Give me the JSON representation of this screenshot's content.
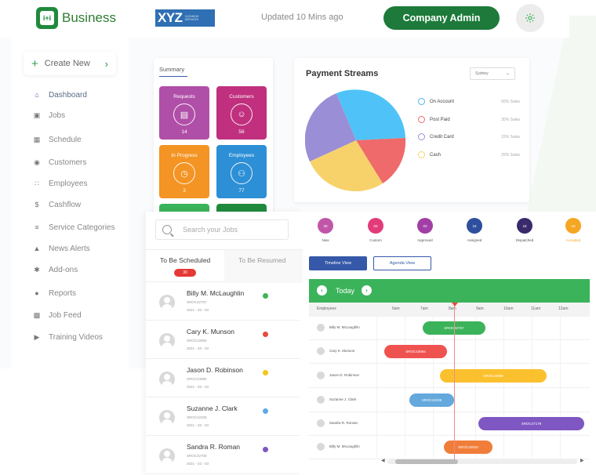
{
  "brand": {
    "logo_mark": "i+i",
    "name": "Business",
    "partner_logo_big": "XYZ",
    "partner_logo_small": "CLEANING SERVICES"
  },
  "header": {
    "updated": "Updated 10 Mins ago",
    "company_button": "Company Admin",
    "settings_icon": "gear-icon"
  },
  "sidebar": {
    "create_new": "Create New",
    "items": [
      {
        "label": "Dashboard",
        "icon": "home-icon",
        "active": true
      },
      {
        "label": "Jobs",
        "icon": "briefcase-icon"
      },
      {
        "label": "Schedule",
        "icon": "calendar-icon"
      },
      {
        "label": "Customers",
        "icon": "customer-icon"
      },
      {
        "label": "Employees",
        "icon": "people-icon"
      },
      {
        "label": "Cashflow",
        "icon": "dollar-icon"
      },
      {
        "label": "Service Categories",
        "icon": "list-icon"
      },
      {
        "label": "News Alerts",
        "icon": "bell-icon"
      },
      {
        "label": "Add-ons",
        "icon": "puzzle-icon"
      },
      {
        "label": "Reports",
        "icon": "report-icon"
      },
      {
        "label": "Job Feed",
        "icon": "feed-icon"
      },
      {
        "label": "Training Videos",
        "icon": "video-icon"
      }
    ]
  },
  "summary": {
    "title": "Summary",
    "tiles": [
      {
        "label": "Requests",
        "value": "14",
        "color": "#b04fa8",
        "icon": "document-icon"
      },
      {
        "label": "Customers",
        "value": "56",
        "color": "#c0307e",
        "icon": "user-icon"
      },
      {
        "label": "In Progress",
        "value": "3",
        "color": "#f39424",
        "icon": "clock-icon"
      },
      {
        "label": "Employees",
        "value": "77",
        "color": "#2d8fd5",
        "icon": "worker-icon"
      }
    ]
  },
  "payment": {
    "title": "Payment Streams",
    "filter": "Sydney",
    "legend": [
      {
        "label": "On Account",
        "value": "50% Sales",
        "color": "#4fb3f2"
      },
      {
        "label": "Post Paid",
        "value": "30% Sales",
        "color": "#ef6a6a"
      },
      {
        "label": "Credit Card",
        "value": "15% Sales",
        "color": "#9a8ed6"
      },
      {
        "label": "Cash",
        "value": "25% Sales",
        "color": "#f5d36a"
      }
    ]
  },
  "jobs": {
    "search_placeholder": "Search your Jobs",
    "tab_scheduled": "To Be Scheduled",
    "tab_scheduled_count": "30",
    "tab_resumed": "To Be Resumed",
    "list": [
      {
        "name": "Billy M. McLaughlin",
        "code": "SROC42757",
        "date": "2021 - 03 - 03",
        "dot": "#3bb35a"
      },
      {
        "name": "Cary K. Munson",
        "code": "SROC42694",
        "date": "2021 - 03 - 03",
        "dot": "#e74c3c"
      },
      {
        "name": "Jason D. Robinson",
        "code": "SROC34980",
        "date": "2021 - 03 - 03",
        "dot": "#f5c518"
      },
      {
        "name": "Suzanne J. Clark",
        "code": "SROC42335",
        "date": "2021 - 03 - 03",
        "dot": "#5fa8e8"
      },
      {
        "name": "Sandra R. Roman",
        "code": "SROC42709",
        "date": "2021 - 03 - 03",
        "dot": "#7e57c2"
      }
    ]
  },
  "schedule": {
    "statuses": [
      {
        "label": "New",
        "count": "29",
        "color": "#c156a8"
      },
      {
        "label": "Custom",
        "count": "03",
        "color": "#e33b7a"
      },
      {
        "label": "Approved",
        "count": "03",
        "color": "#a23fa6"
      },
      {
        "label": "Assigned",
        "count": "16",
        "color": "#2d4f9e"
      },
      {
        "label": "Dispatched",
        "count": "18",
        "color": "#3a2a6b"
      },
      {
        "label": "Accepted",
        "count": "18",
        "color": "#f5a623"
      }
    ],
    "timeline_view": "Timeline View",
    "agenda_view": "Agenda View",
    "today": "Today",
    "employees_header": "Employees",
    "hours": [
      "6am",
      "7am",
      "8am",
      "9am",
      "10am",
      "11am",
      "12am"
    ],
    "rows": [
      {
        "name": "Billy M. McLaughlin",
        "job": "SROC42757",
        "color": "#3bb35a"
      },
      {
        "name": "Cary K. Munson",
        "job": "SROC42694",
        "color": "#ef5350"
      },
      {
        "name": "Jason D. Robinson",
        "job": "SROC34980",
        "color": "#fbc02d"
      },
      {
        "name": "Suzanne J. Clark",
        "job": "SROC42335",
        "color": "#64a8dc"
      },
      {
        "name": "Sandra R. Roman",
        "job": "SROC47179",
        "color": "#7e57c2"
      },
      {
        "name": "Billy M. McLaughlin",
        "job": "SROC42810",
        "color": "#f07e3a"
      }
    ]
  }
}
